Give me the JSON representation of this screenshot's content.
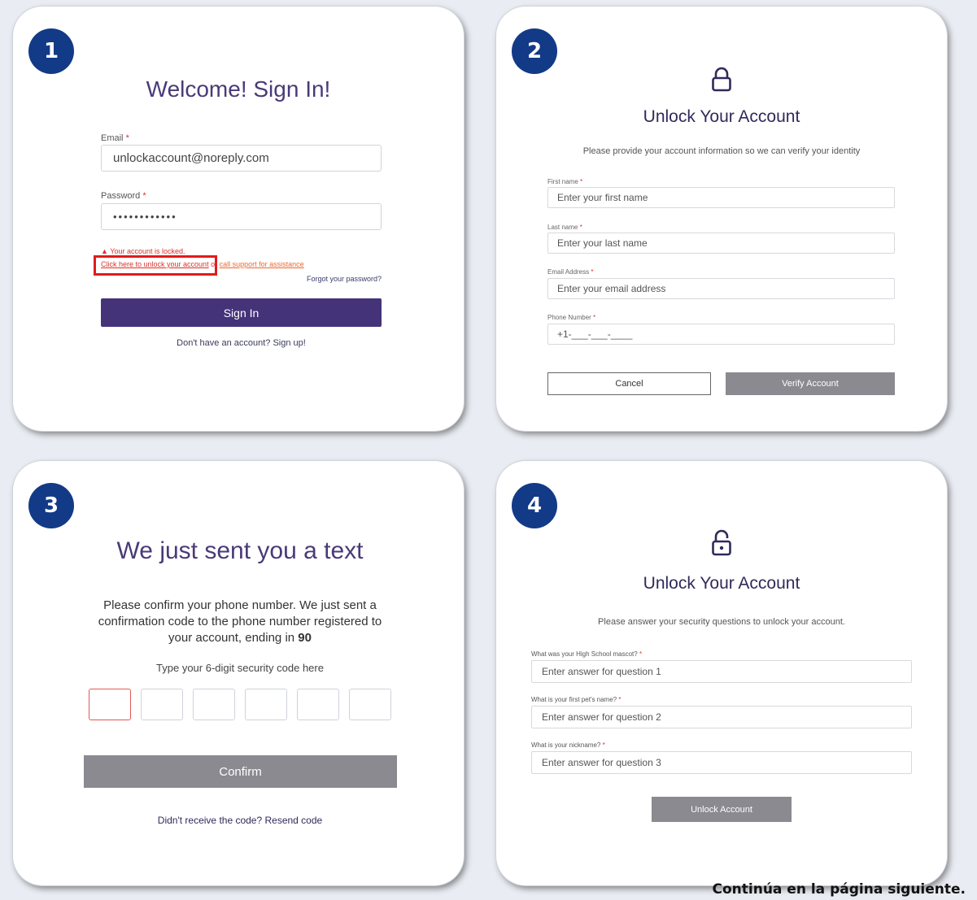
{
  "step_numbers": [
    "1",
    "2",
    "3",
    "4"
  ],
  "signin": {
    "title": "Welcome! Sign In!",
    "email_label": "Email",
    "email_value": "unlockaccount@noreply.com",
    "password_label": "Password",
    "password_value": "••••••••••••",
    "required_mark": "*",
    "locked_message": "Your account is locked.",
    "unlock_link": "Click here to unlock your account",
    "or_text": "or",
    "support_link": "call support for assistance",
    "forgot_link": "Forgot your password?",
    "signin_button": "Sign In",
    "signup_link": "Don't have an account? Sign up!"
  },
  "verify": {
    "title": "Unlock Your Account",
    "subtitle": "Please provide your account information so we can verify your identity",
    "first_name_label": "First name",
    "first_name_placeholder": "Enter your first name",
    "last_name_label": "Last name",
    "last_name_placeholder": "Enter your last name",
    "email_label": "Email Address",
    "email_placeholder": "Enter your email address",
    "phone_label": "Phone Number",
    "phone_placeholder": "+1-___-___-____",
    "cancel_button": "Cancel",
    "verify_button": "Verify Account"
  },
  "code": {
    "title": "We just sent you a text",
    "body_line1": "Please confirm your phone number. We just sent a",
    "body_line2": "confirmation code to the phone number registered to",
    "body_line3_prefix": "your account, ending in ",
    "ending_digits": "90",
    "hint": "Type your 6-digit security code here",
    "confirm_button": "Confirm",
    "resend_link": "Didn't receive the code? Resend code"
  },
  "security": {
    "title": "Unlock Your Account",
    "subtitle": "Please answer your security questions to unlock your account.",
    "q1_label": "What was your High School mascot?",
    "q1_placeholder": "Enter answer for question 1",
    "q2_label": "What is your first pet's name?",
    "q2_placeholder": "Enter answer for question 2",
    "q3_label": "What is your nickname?",
    "q3_placeholder": "Enter answer for question 3",
    "unlock_button": "Unlock Account"
  },
  "footer_text": "Continúa en la página siguiente.",
  "colors": {
    "step_badge": "#123a86",
    "primary_purple": "#45337a",
    "error_red": "#d9342b",
    "button_gray": "#8a8a90",
    "highlight_box": "#e11b1b"
  },
  "icons": {
    "locked": "lock-icon",
    "unlocked": "unlock-icon",
    "warning": "warning-icon"
  }
}
